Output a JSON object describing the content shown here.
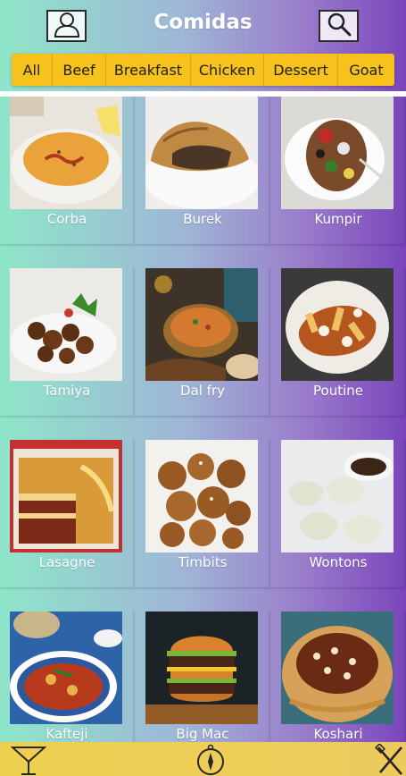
{
  "header": {
    "title": "Comidas",
    "profile_icon": "user-icon",
    "search_icon": "search-icon"
  },
  "categories": [
    {
      "label": "All"
    },
    {
      "label": "Beef"
    },
    {
      "label": "Breakfast"
    },
    {
      "label": "Chicken"
    },
    {
      "label": "Dessert"
    },
    {
      "label": "Goat"
    }
  ],
  "meals": [
    {
      "name": "Corba"
    },
    {
      "name": "Burek"
    },
    {
      "name": "Kumpir"
    },
    {
      "name": "Tamiya"
    },
    {
      "name": "Dal fry"
    },
    {
      "name": "Poutine"
    },
    {
      "name": "Lasagne"
    },
    {
      "name": "Timbits"
    },
    {
      "name": "Wontons"
    },
    {
      "name": "Kafteji"
    },
    {
      "name": "Big Mac"
    },
    {
      "name": "Koshari"
    }
  ],
  "bottom_nav": {
    "left_icon": "cocktail-icon",
    "center_icon": "compass-icon",
    "right_icon": "utensils-icon"
  },
  "colors": {
    "category_bar": "#f7c21b",
    "gradient_start": "#8ee6c9",
    "gradient_end": "#7a45bb",
    "bottom_bar": "#f3cf4a"
  }
}
